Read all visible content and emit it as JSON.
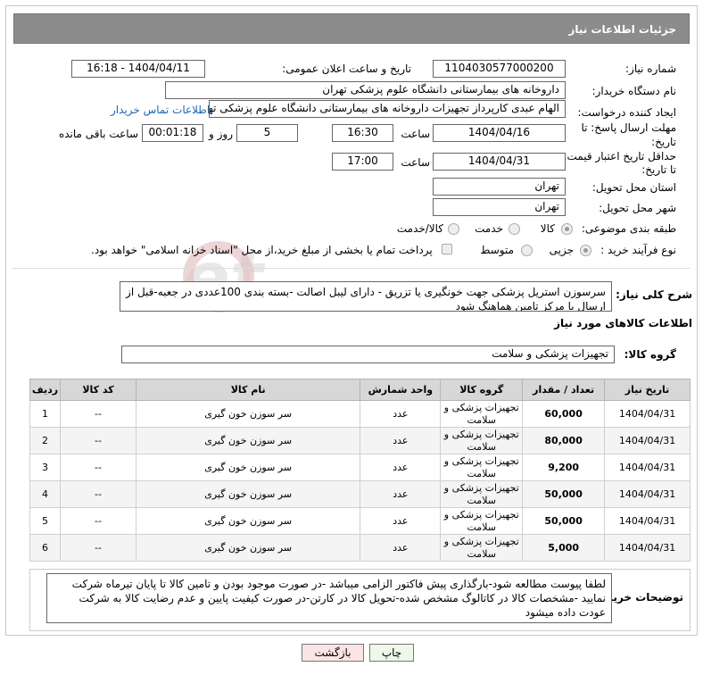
{
  "header": {
    "title": "جزئیات اطلاعات نیاز"
  },
  "fields": {
    "need_number_label": "شماره نیاز:",
    "need_number": "1104030577000200",
    "announce_label": "تاریخ و ساعت اعلان عمومی:",
    "announce_value": "1404/04/11 - 16:18",
    "buyer_org_label": "نام دستگاه خریدار:",
    "buyer_org": "داروخانه های بیمارستانی دانشگاه علوم پزشکی تهران",
    "creator_label": "ایجاد کننده درخواست:",
    "creator": "الهام عبدی کارپرداز تجهیزات داروخانه های بیمارستانی دانشگاه علوم پزشکی تهران",
    "contact_link": "اطلاعات تماس خریدار",
    "deadline_label_1": "مهلت ارسال پاسخ: تا",
    "deadline_label_2": "تاریخ:",
    "deadline_date": "1404/04/16",
    "time_label": "ساعت",
    "deadline_time": "16:30",
    "days_value": "5",
    "days_label": "روز و",
    "remaining_value": "00:01:18",
    "remaining_label": "ساعت باقی مانده",
    "validity_label_1": "حداقل تاریخ اعتبار قیمت:",
    "validity_label_2": "تا تاریخ:",
    "validity_date": "1404/04/31",
    "validity_time": "17:00",
    "province_label": "استان محل تحویل:",
    "province": "تهران",
    "city_label": "شهر محل تحویل:",
    "city": "تهران",
    "category_label": "طبقه بندی موضوعی:",
    "category_options": [
      "کالا",
      "خدمت",
      "کالا/خدمت"
    ],
    "category_selected": "کالا",
    "process_label": "نوع فرآیند خرید :",
    "process_options": [
      "جزیی",
      "متوسط"
    ],
    "process_selected": "جزیی",
    "payment_note": "پرداخت تمام یا بخشی از مبلغ خرید،از محل \"اسناد خزانه اسلامی\" خواهد بود."
  },
  "general_desc": {
    "label": "شرح کلی نیاز:",
    "text": "سرسوزن استریل پزشکی جهت خونگیری یا تزریق - دارای لیبل اصالت -بسته بندی 100عددی در جعبه-قبل از ارسال با مرکز تامین هماهنگ شود"
  },
  "goods": {
    "section_title": "اطلاعات کالاهای مورد نیاز",
    "group_label": "گروه کالا:",
    "group_value": "تجهیزات پزشکی و سلامت",
    "columns": [
      "ردیف",
      "کد کالا",
      "نام کالا",
      "واحد شمارش",
      "گروه کالا",
      "تعداد / مقدار",
      "تاریخ نیاز"
    ],
    "rows": [
      {
        "row": "1",
        "code": "--",
        "name": "سر سوزن خون گیری",
        "unit": "عدد",
        "group": "تجهیزات پزشکی و سلامت",
        "qty": "60,000",
        "date": "1404/04/31"
      },
      {
        "row": "2",
        "code": "--",
        "name": "سر سوزن خون گیری",
        "unit": "عدد",
        "group": "تجهیزات پزشکی و سلامت",
        "qty": "80,000",
        "date": "1404/04/31"
      },
      {
        "row": "3",
        "code": "--",
        "name": "سر سوزن خون گیری",
        "unit": "عدد",
        "group": "تجهیزات پزشکی و سلامت",
        "qty": "9,200",
        "date": "1404/04/31"
      },
      {
        "row": "4",
        "code": "--",
        "name": "سر سوزن خون گیری",
        "unit": "عدد",
        "group": "تجهیزات پزشکی و سلامت",
        "qty": "50,000",
        "date": "1404/04/31"
      },
      {
        "row": "5",
        "code": "--",
        "name": "سر سوزن خون گیری",
        "unit": "عدد",
        "group": "تجهیزات پزشکی و سلامت",
        "qty": "50,000",
        "date": "1404/04/31"
      },
      {
        "row": "6",
        "code": "--",
        "name": "سر سوزن خون گیری",
        "unit": "عدد",
        "group": "تجهیزات پزشکی و سلامت",
        "qty": "5,000",
        "date": "1404/04/31"
      }
    ]
  },
  "buyer_notes": {
    "label": "توضیحات خریدار:",
    "text": "لطفا پیوست مطالعه شود-بارگذاری پیش فاکتور الزامی میباشد -در صورت موجود بودن و تامین کالا تا پایان تیرماه شرکت نمایید -مشخصات کالا در کاتالوگ مشخص شده-تحویل کالا در کارتن-در صورت کیفیت پایین و عدم رضایت کالا به شرکت عودت داده میشود"
  },
  "buttons": {
    "print": "چاپ",
    "back": "بازگشت"
  },
  "colors": {
    "header_bg": "#8c8c8c",
    "back_btn_bg": "#fbe4e4",
    "print_btn_bg": "#eef8e6",
    "link": "#2166b0"
  },
  "watermark": "AriaTender.net"
}
